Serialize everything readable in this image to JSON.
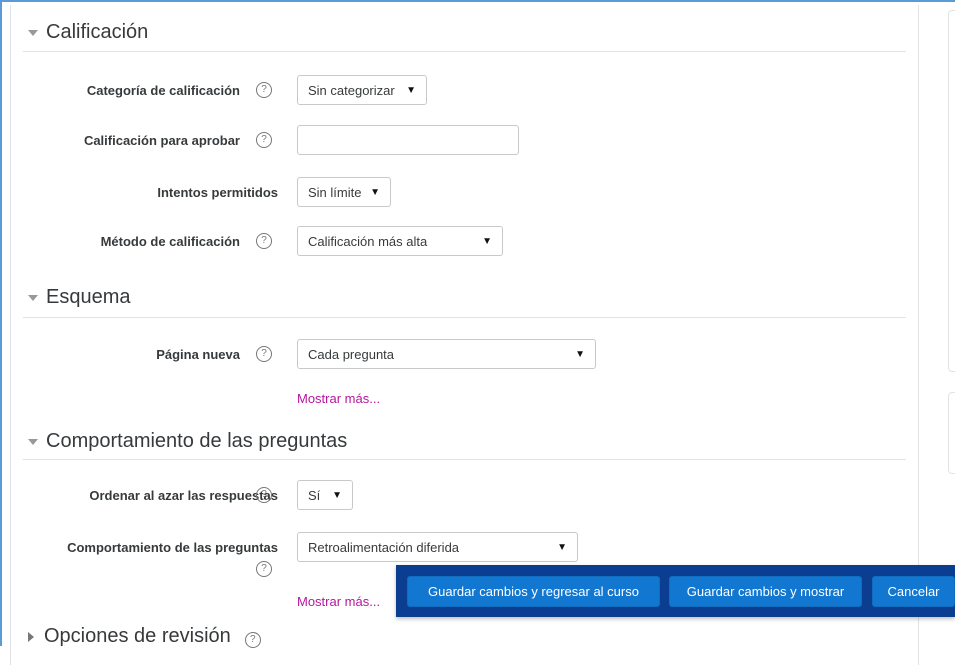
{
  "sections": {
    "calificacion": {
      "title": "Calificación"
    },
    "esquema": {
      "title": "Esquema"
    },
    "comportamiento": {
      "title": "Comportamiento de las preguntas"
    },
    "revision": {
      "title": "Opciones de revisión"
    }
  },
  "fields": {
    "categoria": {
      "label": "Categoría de calificación",
      "value": "Sin categorizar"
    },
    "aprobar": {
      "label": "Calificación para aprobar",
      "value": ""
    },
    "intentos": {
      "label": "Intentos permitidos",
      "value": "Sin límite"
    },
    "metodo": {
      "label": "Método de calificación",
      "value": "Calificación más alta"
    },
    "pagina": {
      "label": "Página nueva",
      "value": "Cada pregunta"
    },
    "azar": {
      "label": "Ordenar al azar las respuestas",
      "value": "Sí"
    },
    "comportamiento": {
      "label": "Comportamiento de las preguntas",
      "value": "Retroalimentación diferida"
    }
  },
  "links": {
    "mostrar_mas_esquema": "Mostrar más...",
    "mostrar_mas_comportamiento": "Mostrar más..."
  },
  "buttons": {
    "save_return": "Guardar cambios y regresar al curso",
    "save_show": "Guardar cambios y mostrar",
    "cancel": "Cancelar"
  },
  "icons": {
    "help": "?"
  },
  "colors": {
    "primary_button": "#1177d1",
    "button_bar": "#0b3d91",
    "link": "#b5179e"
  }
}
